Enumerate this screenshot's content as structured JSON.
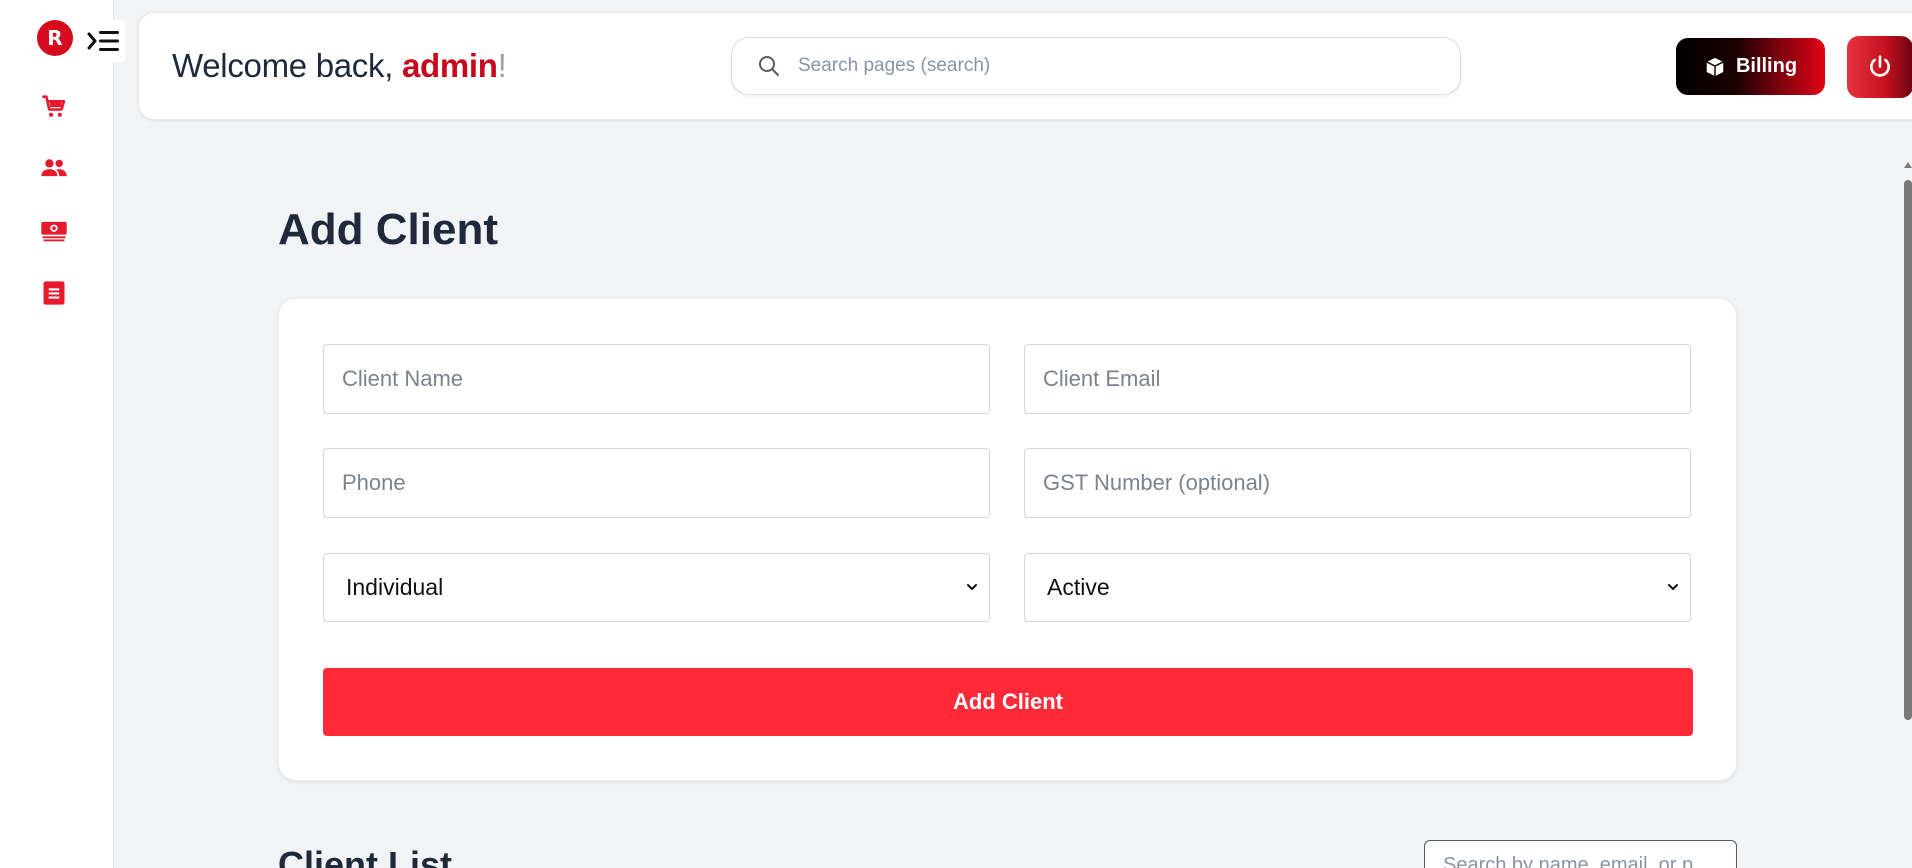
{
  "app": {
    "logo_letter": "R",
    "accent_color": "#fe2a38",
    "brand_color": "#d60a1e"
  },
  "sidebar": {
    "toggle_icon": "menu-indent-icon",
    "items": [
      {
        "icon": "cart-icon"
      },
      {
        "icon": "users-icon"
      },
      {
        "icon": "money-icon"
      },
      {
        "icon": "document-icon"
      }
    ]
  },
  "header": {
    "welcome_prefix": "Welcome back, ",
    "user_name": "admin",
    "welcome_suffix": "!",
    "search_placeholder": "Search pages (search)",
    "billing_label": "Billing"
  },
  "main": {
    "title": "Add Client",
    "form": {
      "client_name_placeholder": "Client Name",
      "client_email_placeholder": "Client Email",
      "phone_placeholder": "Phone",
      "gst_placeholder": "GST Number (optional)",
      "client_type": "Individual",
      "status": "Active",
      "submit_label": "Add Client"
    },
    "list": {
      "title": "Client List",
      "search_placeholder": "Search by name, email, or p"
    }
  }
}
